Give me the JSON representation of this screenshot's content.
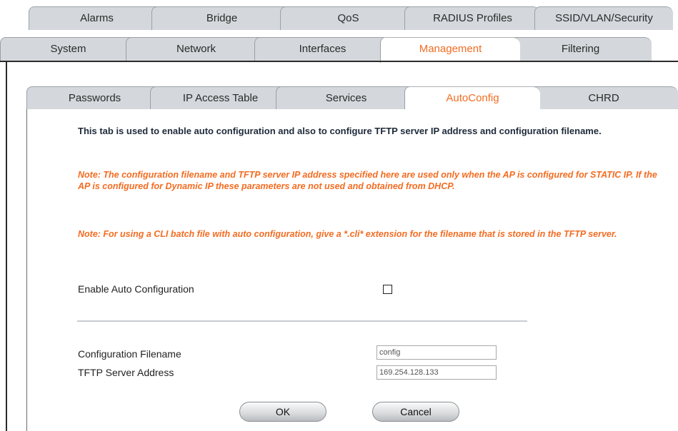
{
  "tabs_row1": [
    "Alarms",
    "Bridge",
    "QoS",
    "RADIUS Profiles",
    "SSID/VLAN/Security"
  ],
  "tabs_row2": [
    "System",
    "Network",
    "Interfaces",
    "Management",
    "Filtering"
  ],
  "tabs_row3": [
    "Passwords",
    "IP Access Table",
    "Services",
    "AutoConfig",
    "CHRD"
  ],
  "active": {
    "row2": "Management",
    "row3": "AutoConfig"
  },
  "content": {
    "description": "This tab is used to enable auto configuration and also to configure TFTP server IP address and configuration filename.",
    "note1": "Note: The configuration filename and TFTP server IP address specified here are used only when the AP is configured for STATIC IP. If the AP is configured for Dynamic IP these parameters are not used and obtained from DHCP.",
    "note2": "Note: For using a CLI batch file with auto configuration, give a *.cli* extension for the filename that is stored in the TFTP server.",
    "enable_label": "Enable Auto Configuration",
    "enable_checked": false,
    "filename_label": "Configuration Filename",
    "filename_value": "config",
    "tftp_label": "TFTP Server Address",
    "tftp_value": "169.254.128.133"
  },
  "buttons": {
    "ok": "OK",
    "cancel": "Cancel"
  },
  "colors": {
    "accent": "#f36c21",
    "tab_bg": "#d4d8dc"
  }
}
